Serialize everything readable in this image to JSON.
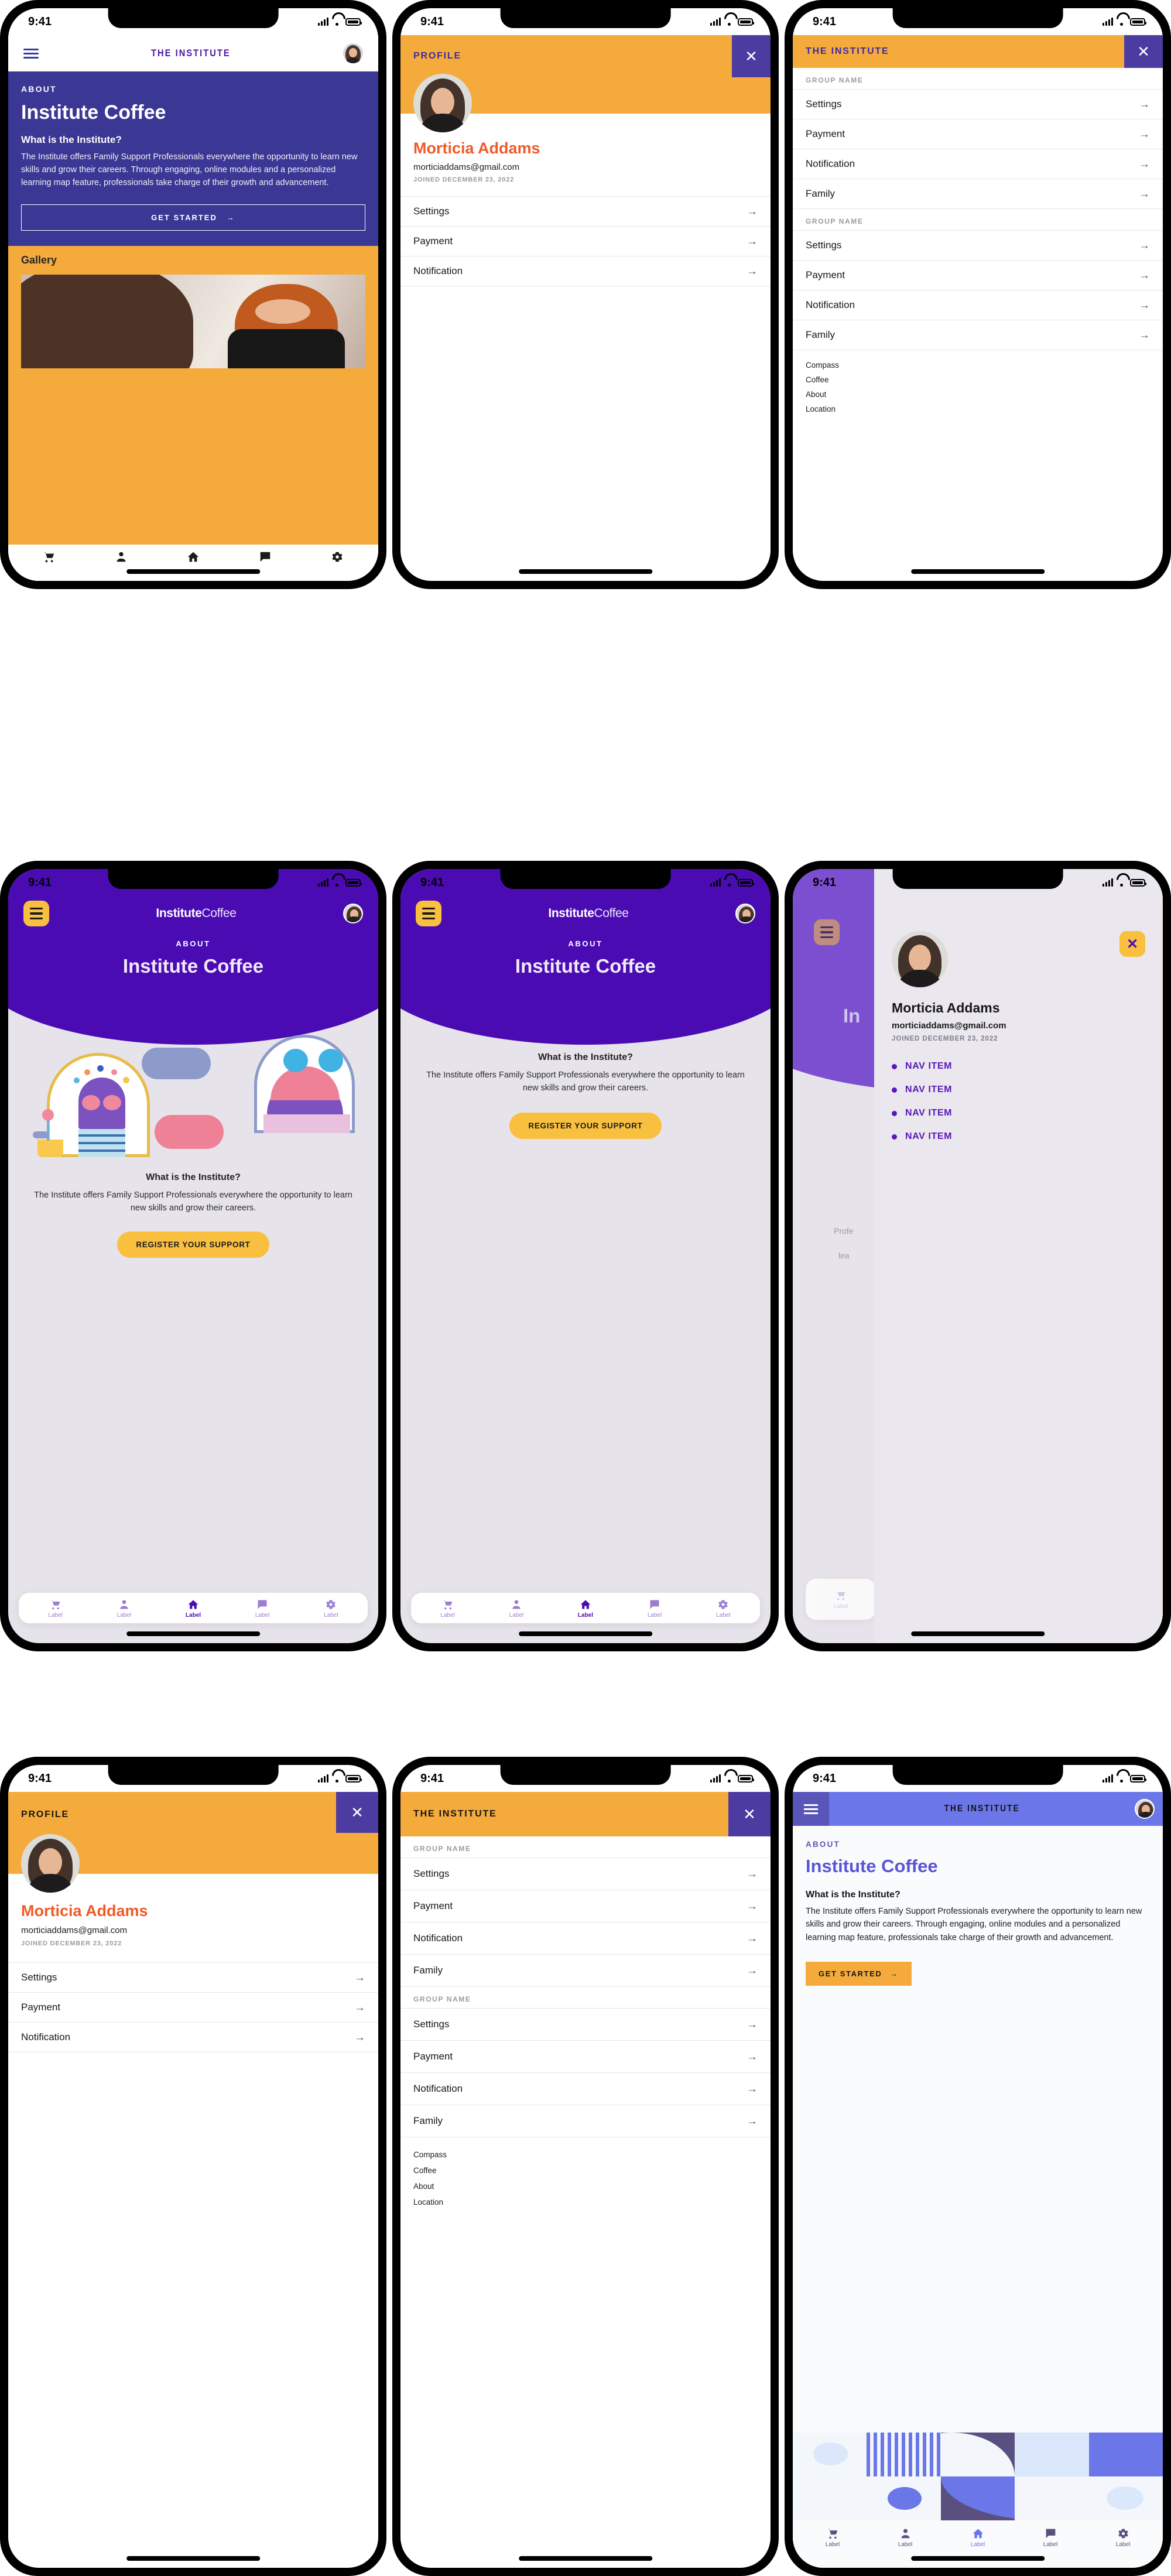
{
  "palette": {
    "indigo": "#3b3795",
    "deep_purple": "#4b0bb3",
    "violet": "#5a17b8",
    "slate_purple": "#4c3ba0",
    "periwinkle": "#6b76e8",
    "amber": "#f5ab3c",
    "yellow": "#f9bf3f",
    "orange_red": "#f05a28",
    "grey_bg": "#e6e4ea",
    "light_blue": "#dbe8fb"
  },
  "status_bar": {
    "time": "9:41",
    "signal_icon": "cellular-bars-icon",
    "wifi_icon": "wifi-icon",
    "battery_icon": "battery-icon"
  },
  "common": {
    "brand_wordmark": "THE INSTITUTE",
    "brand_wordmark_alt_bold": "Institute",
    "brand_wordmark_alt_light": "Coffee",
    "menu_icon": "hamburger-menu-icon",
    "avatar_icon": "user-avatar",
    "close_icon": "close-x-icon",
    "arrow_right": "→",
    "chevron_right_icon": "arrow-right-icon"
  },
  "tabbar": {
    "items": [
      {
        "icon": "shopping-cart-icon",
        "label": "Label"
      },
      {
        "icon": "person-icon",
        "label": "Label"
      },
      {
        "icon": "home-icon",
        "label": "Label"
      },
      {
        "icon": "chat-bubble-icon",
        "label": "Label"
      },
      {
        "icon": "gear-icon",
        "label": "Label"
      }
    ]
  },
  "phone1": {
    "header_title": "THE INSTITUTE",
    "eyebrow": "ABOUT",
    "title": "Institute Coffee",
    "question": "What is the Institute?",
    "paragraph": "The Institute offers Family Support Professionals everywhere the opportunity to learn new skills and grow their careers. Through engaging, online modules and a personalized learning map feature, professionals take charge of their growth and advancement.",
    "cta": "GET STARTED",
    "gallery_label": "Gallery"
  },
  "phone2": {
    "header_title": "PROFILE",
    "name": "Morticia Addams",
    "email": "morticiaddams@gmail.com",
    "joined": "JOINED DECEMBER 23, 2022",
    "rows": [
      "Settings",
      "Payment",
      "Notification"
    ]
  },
  "phone3": {
    "header_title": "THE INSTITUTE",
    "groups": [
      {
        "label": "GROUP NAME",
        "items": [
          "Settings",
          "Payment",
          "Notification",
          "Family"
        ]
      },
      {
        "label": "GROUP NAME",
        "items": [
          "Settings",
          "Payment",
          "Notification",
          "Family"
        ]
      }
    ],
    "footer_links": [
      "Compass",
      "Coffee",
      "About",
      "Location"
    ]
  },
  "phone4": {
    "brand_bold": "Institute",
    "brand_light": "Coffee",
    "eyebrow": "ABOUT",
    "title": "Institute Coffee",
    "question": "What is the Institute?",
    "paragraph": "The Institute offers Family Support Professionals everywhere the opportunity to learn new skills and grow their careers.",
    "cta": "REGISTER YOUR SUPPORT"
  },
  "phone5": {
    "brand_bold": "Institute",
    "brand_light": "Coffee",
    "eyebrow": "ABOUT",
    "title": "Institute Coffee",
    "question": "What is the Institute?",
    "paragraph": "The Institute offers Family Support Professionals everywhere the opportunity to learn new skills and grow their careers.",
    "cta": "REGISTER YOUR SUPPORT"
  },
  "phone6": {
    "name": "Morticia Addams",
    "email": "morticiaddams@gmail.com",
    "joined": "JOINED DECEMBER 23, 2022",
    "nav_items": [
      "NAV ITEM",
      "NAV ITEM",
      "NAV ITEM",
      "NAV ITEM"
    ],
    "behind_title_fragment": "In",
    "behind_text_1": "Profe",
    "behind_text_2": "lea"
  },
  "phone7": {
    "header_title": "PROFILE",
    "name": "Morticia Addams",
    "email": "morticiaddams@gmail.com",
    "joined": "JOINED DECEMBER 23, 2022",
    "rows": [
      "Settings",
      "Payment",
      "Notification"
    ]
  },
  "phone8": {
    "header_title": "THE INSTITUTE",
    "groups": [
      {
        "label": "GROUP NAME",
        "items": [
          "Settings",
          "Payment",
          "Notification",
          "Family"
        ]
      },
      {
        "label": "GROUP NAME",
        "items": [
          "Settings",
          "Payment",
          "Notification",
          "Family"
        ]
      }
    ],
    "footer_links": [
      "Compass",
      "Coffee",
      "About",
      "Location"
    ]
  },
  "phone9": {
    "header_title": "THE INSTITUTE",
    "eyebrow": "ABOUT",
    "title": "Institute Coffee",
    "question": "What is the Institute?",
    "paragraph": "The Institute offers Family Support Professionals everywhere the opportunity to learn new skills and grow their careers. Through engaging, online modules and a personalized learning map feature, professionals take charge of their growth and advancement.",
    "cta": "GET STARTED"
  }
}
